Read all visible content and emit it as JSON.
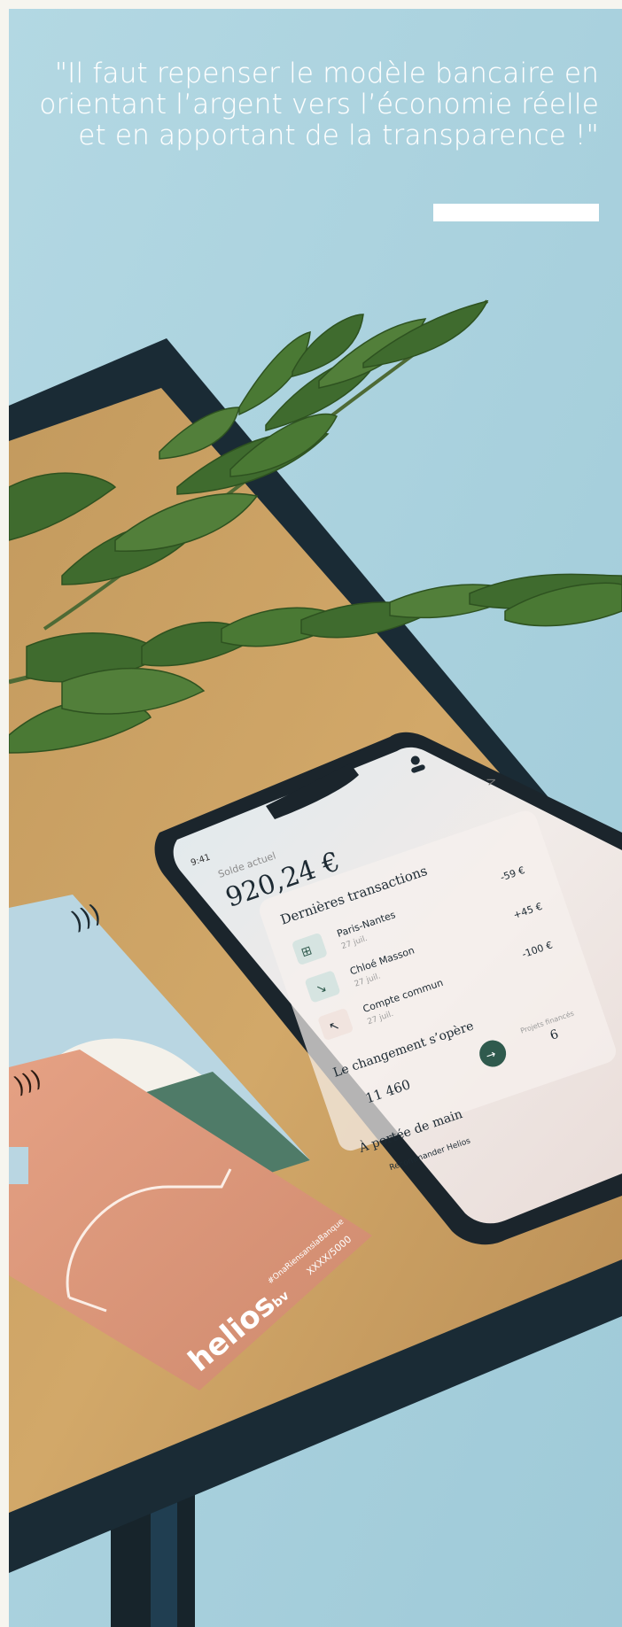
{
  "quote": {
    "text": "\"Il faut repenser le modèle bancaire  en orientant l’argent vers l’économie réelle et en apportant de la transparence !\""
  },
  "phone": {
    "time": "9:41",
    "balance_label": "Solde actuel",
    "balance": "920,24 €",
    "balance_chevron": ">",
    "transactions_title": "Dernières transactions",
    "transactions": [
      {
        "name": "Paris-Nantes",
        "date": "27 juil.",
        "amount": "-59 €"
      },
      {
        "name": "Chloé Masson",
        "date": "27 juil.",
        "amount": "+45 €"
      },
      {
        "name": "Compte commun",
        "date": "27 juil.",
        "amount": "-100 €"
      }
    ],
    "change_title": "Le changement s’opère",
    "change_value": "11 460",
    "projects_label": "Projets financés",
    "projects_value": "6",
    "reach_title": "À portée de main",
    "recommend_label": "Recommander Helios"
  },
  "cards": {
    "brand": "helios",
    "brand_suffix": "bv",
    "hashtag": "#OnaRiensanslaBanque",
    "number": "XXXX/5000"
  }
}
